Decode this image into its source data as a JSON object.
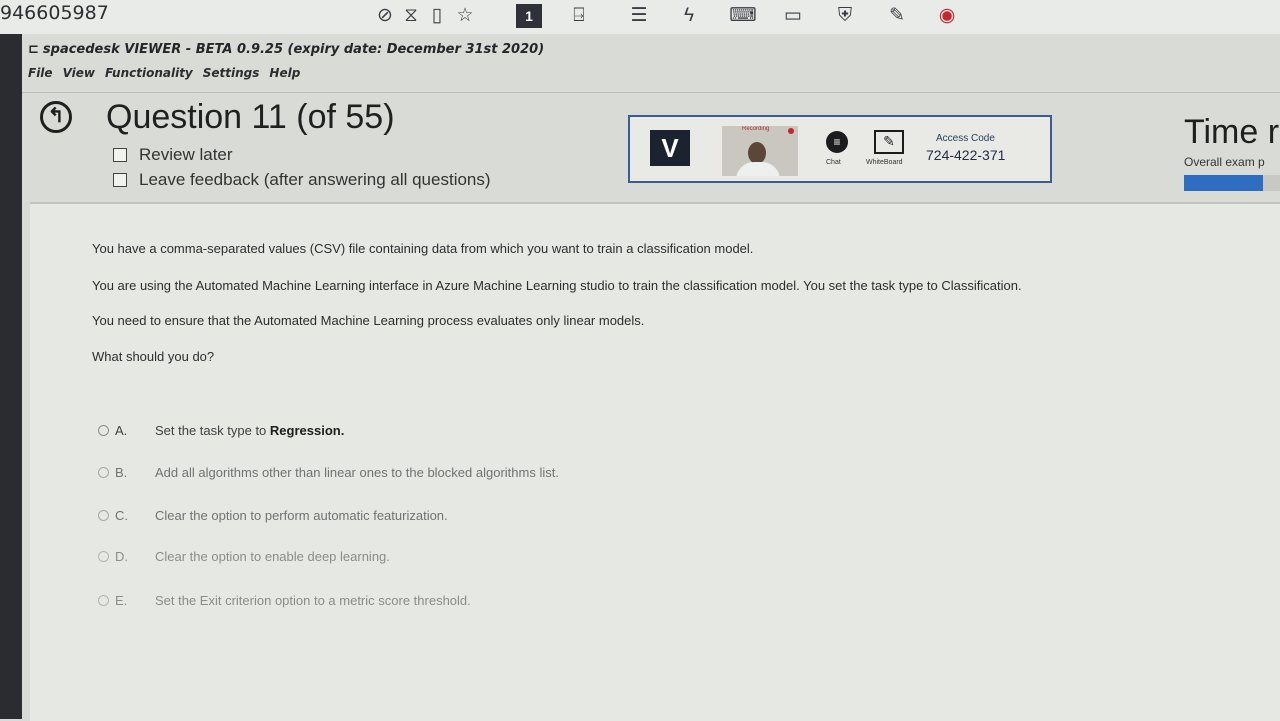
{
  "toolbar": {
    "session_id": "946605987",
    "active_monitor": "1",
    "icons": [
      "eye-off-icon",
      "hourglass-icon",
      "cylinder-icon",
      "star-icon",
      "monitor-1-icon",
      "send-icon",
      "message-icon",
      "lightning-icon",
      "keyboard-icon",
      "display-icon",
      "shield-icon",
      "pen-icon",
      "record-icon"
    ]
  },
  "app": {
    "title": "spacedesk VIEWER - BETA 0.9.25 (expiry date: December 31st 2020)",
    "menu": [
      "File",
      "View",
      "Functionality",
      "Settings",
      "Help"
    ]
  },
  "exam": {
    "question_title": "Question 11 (of 55)",
    "review_later": "Review later",
    "leave_feedback": "Leave feedback (after answering all questions)"
  },
  "proctor": {
    "logo_letter": "V",
    "recording_label": "Recording",
    "chat_label": "Chat",
    "whiteboard_label": "WhiteBoard",
    "access_code_label": "Access Code",
    "access_code": "724-422-371"
  },
  "timer": {
    "title": "Time r",
    "subtitle": "Overall exam p",
    "progress": 0.82
  },
  "question": {
    "paragraphs": [
      "You have a comma-separated values (CSV) file containing data from which you want to train a classification model.",
      "You are using the Automated Machine Learning interface in Azure Machine Learning studio to train the classification model. You set the task type to Classification.",
      "You need to ensure that the Automated Machine Learning process evaluates only linear models.",
      "What should you do?"
    ],
    "options": [
      {
        "letter": "A.",
        "text": "Set the task type to ",
        "bold": "Regression."
      },
      {
        "letter": "B.",
        "text": "Add all algorithms other than linear ones to the blocked algorithms list.",
        "bold": ""
      },
      {
        "letter": "C.",
        "text": "Clear the option to perform automatic featurization.",
        "bold": ""
      },
      {
        "letter": "D.",
        "text": "Clear the option to enable deep learning.",
        "bold": ""
      },
      {
        "letter": "E.",
        "text": "Set the Exit criterion option to a metric score threshold.",
        "bold": ""
      }
    ]
  }
}
